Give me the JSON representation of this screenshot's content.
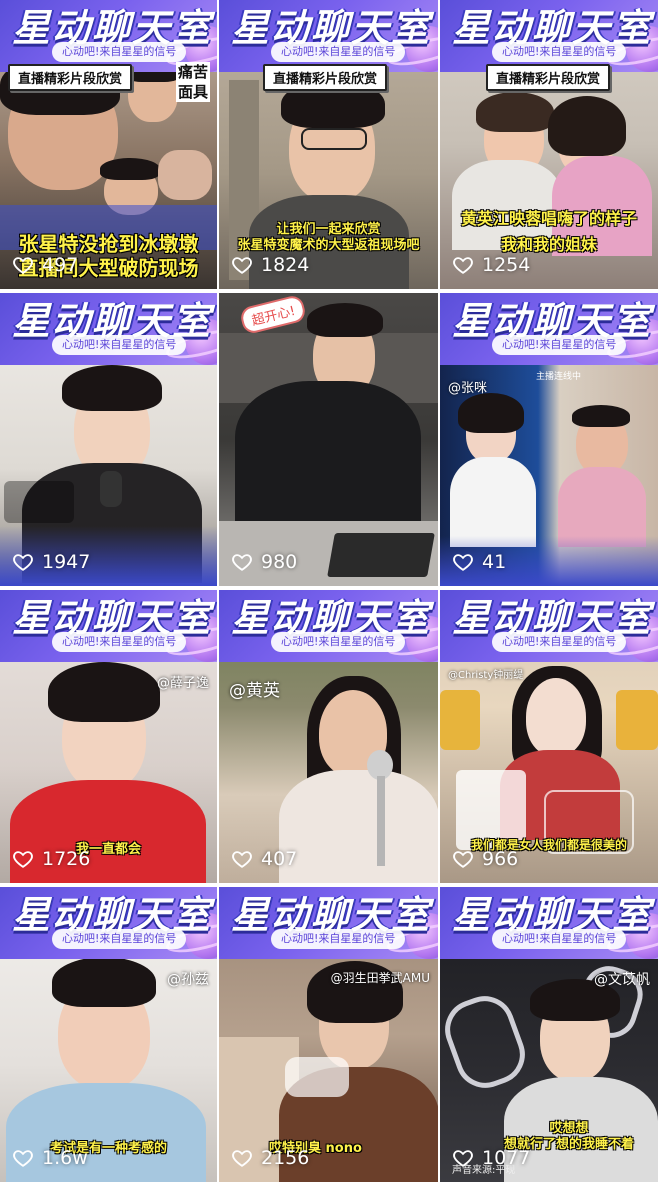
{
  "banner": {
    "title": "星动聊天室",
    "subtitle": "心动吧!来自星星的信号"
  },
  "tiles": [
    {
      "likes": "497",
      "tag": "直播精彩片段欣赏",
      "side_text": "痛苦\n面具",
      "caption": "张星特没抢到冰墩墩\n直播间大型破防现场",
      "user": ""
    },
    {
      "likes": "1824",
      "tag": "直播精彩片段欣赏",
      "caption": "让我们一起来欣赏\n张星特变魔术的大型返祖现场吧",
      "user": ""
    },
    {
      "likes": "1254",
      "tag": "直播精彩片段欣赏",
      "caption": "黄英江映蓉唱嗨了的样子\n我和我的姐妹",
      "user": ""
    },
    {
      "likes": "1947",
      "caption": "",
      "user": ""
    },
    {
      "likes": "980",
      "sticker": "超开心!",
      "caption": "",
      "user": ""
    },
    {
      "likes": "41",
      "caption": "",
      "user": "@张咪",
      "live_label": "主播连线中"
    },
    {
      "likes": "1726",
      "caption": "我一直都会",
      "user": "@薛子逸"
    },
    {
      "likes": "407",
      "caption": "",
      "user": "@黄英"
    },
    {
      "likes": "966",
      "caption": "我们都是女人我们都是很美的",
      "user": "@Christy钟丽缇"
    },
    {
      "likes": "1.6w",
      "caption": "考试是有一种考感的",
      "user": "@孙兹"
    },
    {
      "likes": "2156",
      "caption": "哎特别臭 nono",
      "user": "@羽生田挙武AMU"
    },
    {
      "likes": "1077",
      "caption": "哎想想\n想就行了想的我睡不着",
      "user": "@文苡帆",
      "footnote": "声音来源:平现"
    }
  ],
  "icons": {
    "like": "heart-outline-icon"
  },
  "colors": {
    "banner_start": "#5a4fd9",
    "banner_end": "#a98bf5",
    "caption": "#fff24a"
  }
}
